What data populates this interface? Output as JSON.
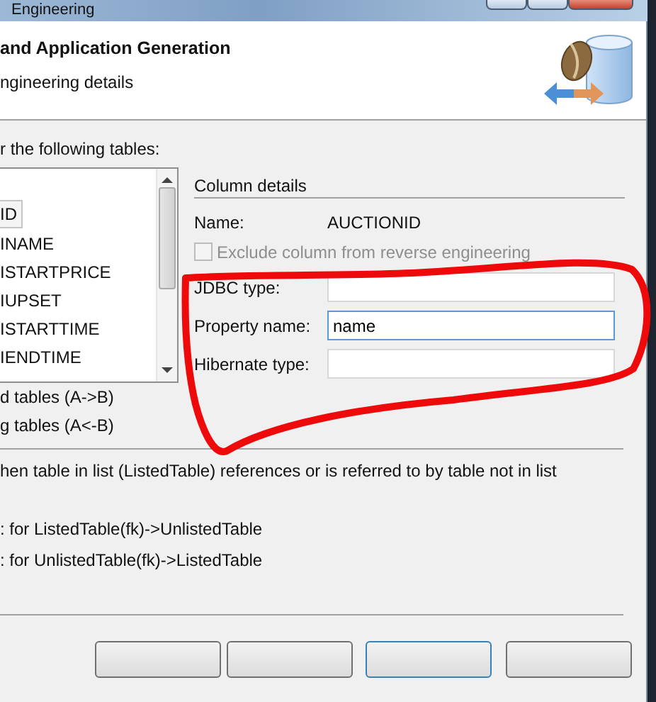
{
  "window": {
    "title": "Engineering"
  },
  "header": {
    "title": "and Application Generation",
    "subtitle": "ngineering details"
  },
  "prompt": "r the following tables:",
  "columns_list": {
    "items": [
      {
        "label": "ID",
        "selected": true
      },
      {
        "label": "INAME",
        "selected": false
      },
      {
        "label": "ISTARTPRICE",
        "selected": false
      },
      {
        "label": "IUPSET",
        "selected": false
      },
      {
        "label": "ISTARTTIME",
        "selected": false
      },
      {
        "label": "IENDTIME",
        "selected": false
      }
    ]
  },
  "column_details": {
    "heading": "Column details",
    "name_label": "Name:",
    "name_value": "AUCTIONID",
    "exclude": {
      "label": "Exclude column from reverse engineering",
      "checked": false,
      "disabled": true
    },
    "fields": [
      {
        "label": "JDBC type:",
        "focused": false
      },
      {
        "label": "Property name:",
        "value": "name",
        "focused": true
      },
      {
        "label": "Hibernate type:",
        "focused": false
      }
    ]
  },
  "options": [
    "d tables (A->B)",
    "g tables (A<-B)"
  ],
  "unlisted": {
    "text": "hen table in list (ListedTable) references or is referred to by table not in list",
    "options": [
      ": for ListedTable(fk)->UnlistedTable",
      ": for UnlistedTable(fk)->ListedTable"
    ]
  },
  "buttons": [
    {
      "default": false
    },
    {
      "default": false
    },
    {
      "default": true
    },
    {
      "default": false
    }
  ]
}
